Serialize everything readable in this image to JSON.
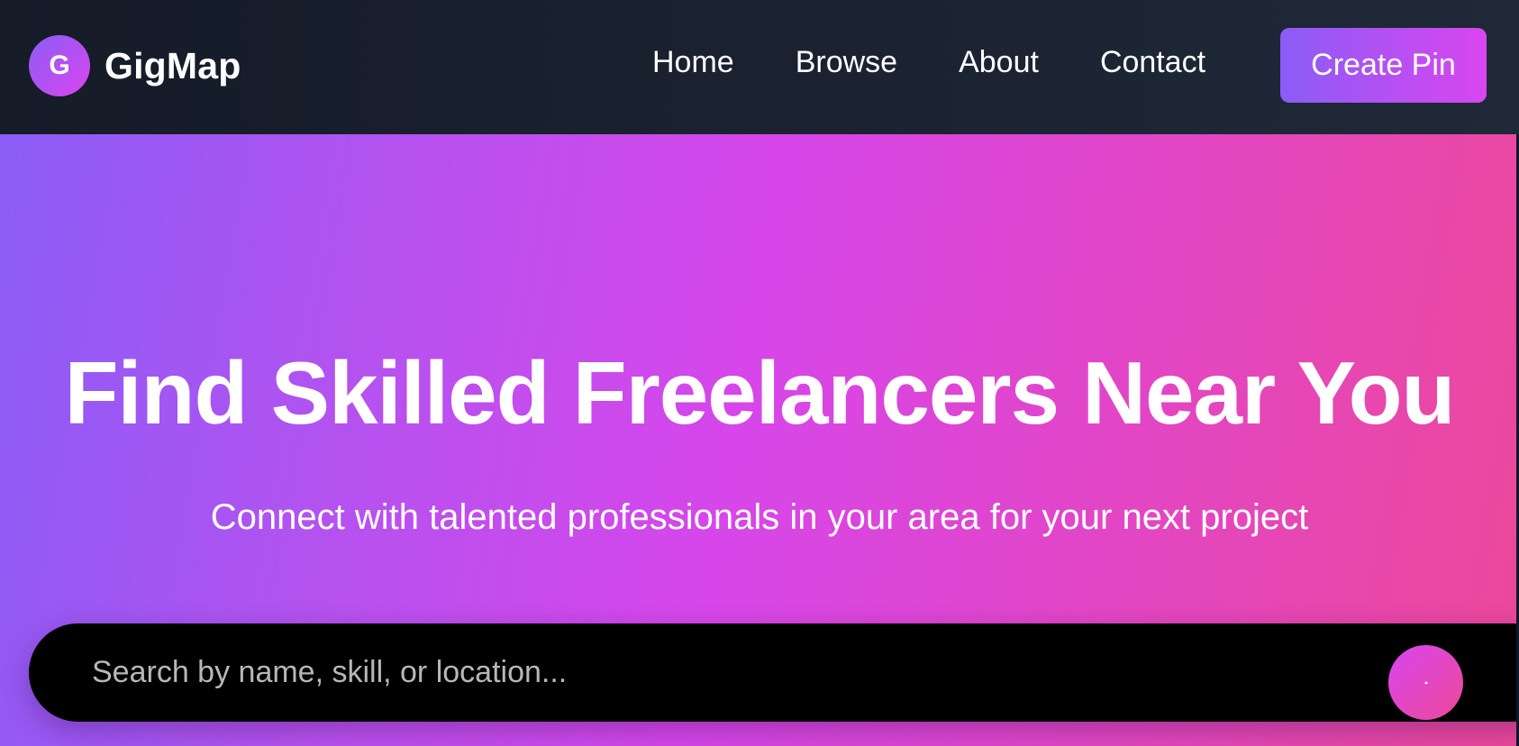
{
  "brand": {
    "logo_letter": "G",
    "name": "GigMap"
  },
  "nav": {
    "links": [
      {
        "label": "Home"
      },
      {
        "label": "Browse"
      },
      {
        "label": "About"
      },
      {
        "label": "Contact"
      }
    ],
    "cta_label": "Create Pin"
  },
  "hero": {
    "title": "Find Skilled Freelancers Near You",
    "subtitle": "Connect with talented professionals in your area for your next project"
  },
  "search": {
    "placeholder": "Search by name, skill, or location...",
    "value": "",
    "button_icon": "search-icon"
  },
  "colors": {
    "nav_bg": "#1b2332",
    "accent_start": "#8b5cf6",
    "accent_mid": "#d946ef",
    "accent_end": "#ec4899",
    "search_bg": "#000000",
    "text": "#ffffff"
  }
}
